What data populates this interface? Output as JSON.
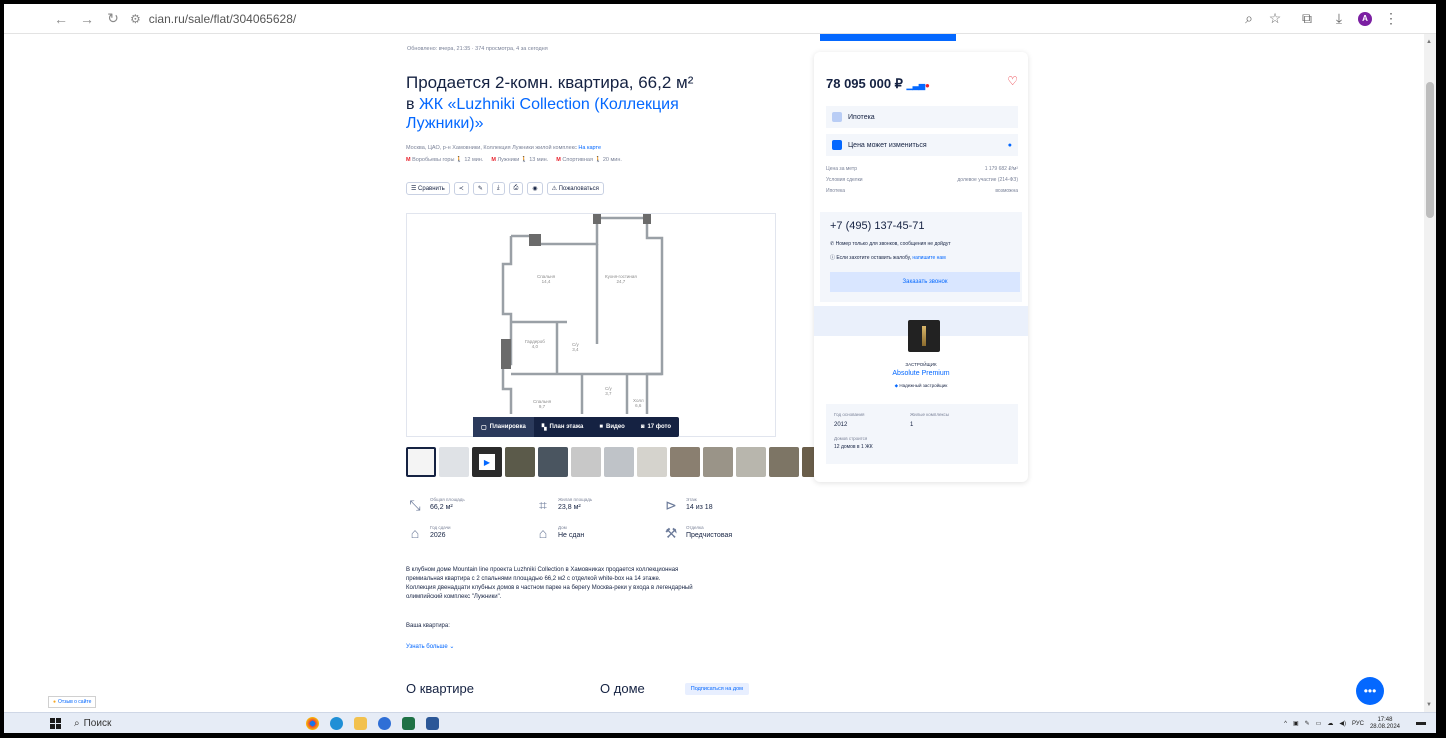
{
  "browser": {
    "url": "cian.ru/sale/flat/304065628/",
    "avatar_letter": "A"
  },
  "listing": {
    "meta": "Обновлено: вчера, 21:35 · 374 просмотра, 4 за сегодня",
    "title": "Продается 2-комн. квартира, 66,2 м²",
    "subtitle_prefix": "в",
    "complex_name": "ЖК «Luzhniki Collection (Коллекция Лужники)»",
    "address": "Москва, ЦАО, р-н Хамовники, Коллекция Лужники жилой комплекс",
    "map_link": "На карте",
    "metro": [
      {
        "name": "Воробьевы горы",
        "time": "12 мин."
      },
      {
        "name": "Лужники",
        "time": "13 мин."
      },
      {
        "name": "Спортивная",
        "time": "20 мин."
      }
    ],
    "actions": {
      "compare": "Сравнить",
      "complain": "Пожаловаться"
    },
    "gallery_tabs": [
      "Планировка",
      "План этажа",
      "Видео",
      "17 фото"
    ],
    "floorplan_rooms": [
      {
        "name": "Спальня",
        "area": "14,4"
      },
      {
        "name": "Кухня-гостиная",
        "area": "24,7"
      },
      {
        "name": "Гардероб",
        "area": "4,0"
      },
      {
        "name": "С/у",
        "area": "3,4"
      },
      {
        "name": "Спальня",
        "area": "9,7"
      },
      {
        "name": "С/у",
        "area": "3,7"
      },
      {
        "name": "Холл",
        "area": "6,6"
      }
    ],
    "facts": [
      {
        "label": "Общая площадь",
        "value": "66,2 м²",
        "icon": "area-icon"
      },
      {
        "label": "Жилая площадь",
        "value": "23,8 м²",
        "icon": "living-area-icon"
      },
      {
        "label": "Этаж",
        "value": "14 из 18",
        "icon": "stairs-icon"
      },
      {
        "label": "Год сдачи",
        "value": "2026",
        "icon": "building-year-icon"
      },
      {
        "label": "Дом",
        "value": "Не сдан",
        "icon": "house-icon"
      },
      {
        "label": "Отделка",
        "value": "Предчистовая",
        "icon": "finish-icon"
      }
    ],
    "description": [
      "В клубном доме Mountain line проекта Luzhniki Collection в Хамовниках продается коллекционная",
      "премиальная квартира с 2 спальнями площадью 66,2 м2 с отделкой white-box на 14 этаже.",
      "Коллекция двенадцати клубных домов в частном парке на берегу Москва-реки у входа в легендарный",
      "олимпийский комплекс \"Лужники\"."
    ],
    "yours": "Ваша квартира:",
    "more": "Узнать больше",
    "section_about_flat": "О квартире",
    "section_about_house": "О доме",
    "subscribe_badge": "Подписаться на дом"
  },
  "card": {
    "price": "78 095 000 ₽",
    "mortgage": "Ипотека",
    "price_may_change": "Цена может измениться",
    "kv": [
      {
        "k": "Цена за метр",
        "v": "1 179 682 ₽/м²"
      },
      {
        "k": "Условия сделки",
        "v": "долевое участие (214-ФЗ)"
      },
      {
        "k": "Ипотека",
        "v": "возможна"
      }
    ],
    "phone": "+7 (495) 137-45-71",
    "phone_note": "Номер только для звонков, сообщения не дойдут",
    "complaint_note": "Если захотите оставить жалобу,",
    "complaint_link": "напишите нам",
    "call_button": "Заказать звонок",
    "developer_label": "ЗАСТРОЙЩИК",
    "developer_name": "Absolute Premium",
    "developer_reliable": "Надежный застройщик",
    "dev_stats": [
      {
        "k": "Год основания",
        "v": "2012"
      },
      {
        "k": "Жилые комплексы",
        "v": "1"
      },
      {
        "k": "Домов строится",
        "v": "12 домов в 1 ЖК"
      }
    ]
  },
  "feedback": "Отзыв о сайте",
  "taskbar": {
    "search": "Поиск",
    "lang": "РУС",
    "time": "17:48",
    "date": "28.08.2024"
  },
  "colors": {
    "accent": "#0468ff",
    "text": "#152242",
    "metro": "#e8222d"
  }
}
